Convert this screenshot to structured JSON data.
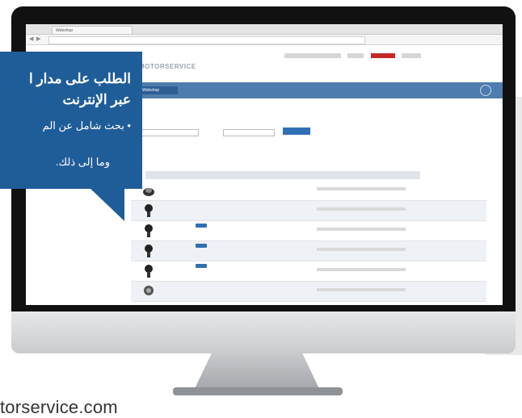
{
  "callout": {
    "title_line1": "الطلب على مدار ا",
    "title_line2": "عبر الإنترنت",
    "bullet_line1": "• بحث شامل عن الم",
    "bullet_line2": "وما إلى ذلك."
  },
  "footer": {
    "url": "torservice.com"
  },
  "browser": {
    "tab_label": "Webshop",
    "back_glyph": "◀",
    "forward_glyph": "▶"
  },
  "site": {
    "logo": "MOTORSERVICE",
    "nav": [
      "Webshop",
      "",
      "",
      ""
    ],
    "partimgs": [
      "part-icon",
      "part-icon",
      "part-icon",
      "part-icon",
      "part-icon",
      "part-icon"
    ]
  },
  "colors": {
    "callout_blue": "#1f5d98",
    "nav_blue": "#4e7cae",
    "bezel": "#111111",
    "aluminium": "#c9cbce"
  }
}
